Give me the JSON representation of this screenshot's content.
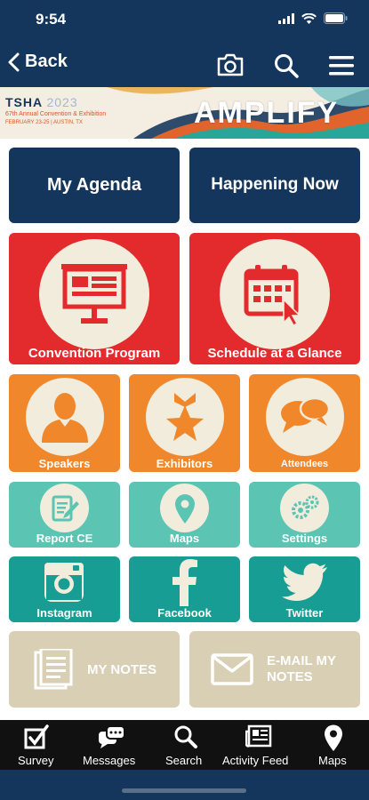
{
  "status": {
    "time": "9:54"
  },
  "nav": {
    "back_label": "Back"
  },
  "banner": {
    "title": "TSHA",
    "year": "2023",
    "subtitle": "67th Annual Convention & Exhibition",
    "dates": "FEBRUARY 23-25  |  AUSTIN, TX",
    "logo_text": "AMPLIFY"
  },
  "tiles": {
    "my_agenda": "My Agenda",
    "happening_now": "Happening Now",
    "convention_program": "Convention Program",
    "schedule": "Schedule at a Glance",
    "speakers": "Speakers",
    "exhibitors": "Exhibitors",
    "attendees": "Attendees",
    "report_ce": "Report CE",
    "maps": "Maps",
    "settings": "Settings",
    "instagram": "Instagram",
    "facebook": "Facebook",
    "twitter": "Twitter",
    "my_notes": "MY NOTES",
    "email_notes_1": "E-MAIL MY",
    "email_notes_2": "NOTES"
  },
  "tabbar": {
    "survey": "Survey",
    "messages": "Messages",
    "search": "Search",
    "activity_feed": "Activity Feed",
    "maps": "Maps"
  },
  "colors": {
    "navy": "#14365c",
    "red": "#e32b2d",
    "orange": "#f0872b",
    "mint": "#5cc4b2",
    "teal": "#179d93",
    "tan": "#d8cfb4",
    "cream": "#f1ecdc"
  }
}
